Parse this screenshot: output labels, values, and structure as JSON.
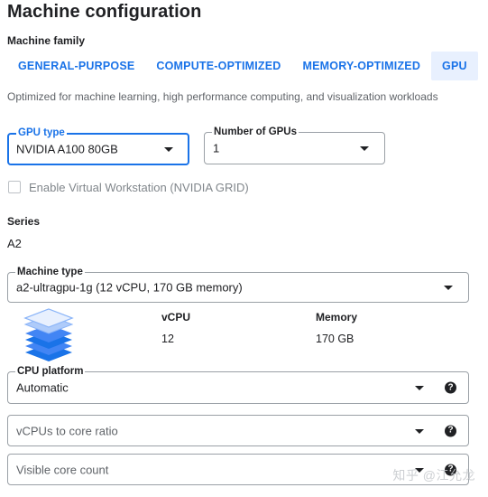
{
  "page": {
    "title": "Machine configuration",
    "machine_family_label": "Machine family",
    "tabs": [
      {
        "label": "GENERAL-PURPOSE",
        "active": false
      },
      {
        "label": "COMPUTE-OPTIMIZED",
        "active": false
      },
      {
        "label": "MEMORY-OPTIMIZED",
        "active": false
      },
      {
        "label": "GPU",
        "active": true
      }
    ],
    "family_description": "Optimized for machine learning, high performance computing, and visualization workloads"
  },
  "gpu": {
    "type_label": "GPU type",
    "type_value": "NVIDIA A100 80GB",
    "count_label": "Number of GPUs",
    "count_value": "1",
    "virtual_workstation_label": "Enable Virtual Workstation (NVIDIA GRID)",
    "virtual_workstation_checked": false
  },
  "series": {
    "label": "Series",
    "value": "A2"
  },
  "machine_type": {
    "label": "Machine type",
    "value": "a2-ultragpu-1g (12 vCPU, 170 GB memory)",
    "vcpu_header": "vCPU",
    "vcpu_value": "12",
    "memory_header": "Memory",
    "memory_value": "170 GB",
    "icon": "stacked-layers-icon"
  },
  "cpu_platform": {
    "label": "CPU platform",
    "value": "Automatic"
  },
  "vcpu_ratio": {
    "placeholder": "vCPUs to core ratio"
  },
  "visible_cores": {
    "placeholder": "Visible core count"
  },
  "watermark": "知乎 @江允龙",
  "colors": {
    "accent": "#1a73e8",
    "tab_active_bg": "#e8f0fe",
    "text": "#202124",
    "muted": "#5f6368"
  }
}
